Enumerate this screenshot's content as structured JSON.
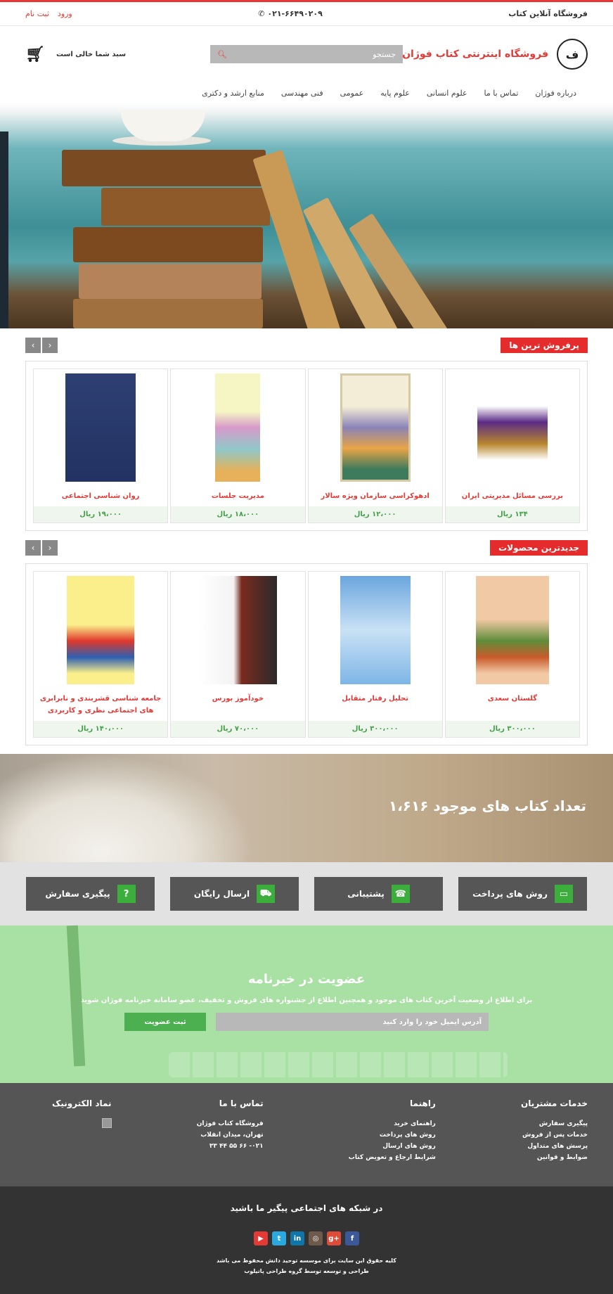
{
  "topbar": {
    "site_label": "فروشگاه آنلاین کتاب",
    "phone": "۰۲۱-۶۶۴۹۰۲۰۹",
    "login": "ورود",
    "register": "ثبت نام"
  },
  "header": {
    "store_name": "فروشگاه اینترنتی کتاب فوژان",
    "logo_text": "فوژان",
    "search_placeholder": "جستجو",
    "cart_status": "سبد شما خالی است"
  },
  "nav": {
    "items": [
      "درباره فوژان",
      "تماس با ما",
      "علوم انسانی",
      "علوم پایه",
      "عمومی",
      "فنی مهندسی",
      "منابع ارشد و دکتری"
    ]
  },
  "bestsellers": {
    "title": "پرفروش ترین ها",
    "items": [
      {
        "title": "بررسی مسائل مدیریتی ایران",
        "price": "۱۳۴ ریال"
      },
      {
        "title": "ادهوکراسی سازمان ویژه سالار",
        "price": "۱۲،۰۰۰ ریال"
      },
      {
        "title": "مدیریت جلسات",
        "price": "۱۸،۰۰۰ ریال"
      },
      {
        "title": "روان شناسی اجتماعی",
        "price": "۱۹،۰۰۰ ریال"
      }
    ]
  },
  "newest": {
    "title": "جدیدترین محصولات",
    "items": [
      {
        "title": "گلستان سعدی",
        "price": "۳۰۰،۰۰۰ ریال"
      },
      {
        "title": "تحلیل رفتار متقابل",
        "price": "۳۰۰،۰۰۰ ریال"
      },
      {
        "title": "خودآموز بورس",
        "price": "۷۰،۰۰۰ ریال"
      },
      {
        "title": "جامعه شناسی قشربندی و نابرابری های اجتماعی نظری و کاربردی",
        "price": "۱۴۰،۰۰۰ ریال"
      }
    ]
  },
  "book_count": {
    "text": "تعداد کتاب های موجود ۱،۶۱۶"
  },
  "features": [
    {
      "label": "روش های پرداخت",
      "icon": "credit-card-icon"
    },
    {
      "label": "پشتیبانی",
      "icon": "contact-card-icon"
    },
    {
      "label": "ارسال رایگان",
      "icon": "truck-icon"
    },
    {
      "label": "پیگیری سفارش",
      "icon": "question-icon"
    }
  ],
  "newsletter": {
    "title": "عضویت در خبرنامه",
    "text": "برای اطلاع از وضعیت آخرین کتاب های موجود و همچنین اطلاع از جشنواره های فروش و تخفیف، عضو سامانه خبرنامه فوژان شوید",
    "email_placeholder": "آدرس ایمیل خود را وارد کنید",
    "button": "ثبت عضویت"
  },
  "footer": {
    "columns": [
      {
        "heading": "خدمات مشتریان",
        "items": [
          "پیگیری سفارش",
          "خدمات پس از فروش",
          "پرسش های متداول",
          "ضوابط و قوانین"
        ]
      },
      {
        "heading": "راهنما",
        "items": [
          "راهنمای خرید",
          "روش های پرداخت",
          "روش های ارسال",
          "شرایط ارجاع و تعویض کتاب"
        ]
      },
      {
        "heading": "تماس با ما",
        "items": [
          "فروشگاه کتاب فوژان",
          "تهران، میدان انقلاب",
          "۰۲۱- ۶۶ ۵۵ ۴۴ ۳۳"
        ]
      },
      {
        "heading": "نماد الکترونیک",
        "items": []
      }
    ]
  },
  "bottom": {
    "social_title": "در شبکه های اجتماعی پیگیر ما باشید",
    "copyright": "کلیه حقوق این سایت برای موسسه توحید دانش محفوظ می باشد",
    "credit": "طراحی و توسعه توسط گروه طراحی پاتیلوب",
    "socials": [
      {
        "name": "youtube",
        "glyph": "▶",
        "color": "#e53935"
      },
      {
        "name": "twitter",
        "glyph": "t",
        "color": "#29a9e0"
      },
      {
        "name": "linkedin",
        "glyph": "in",
        "color": "#0e76a8"
      },
      {
        "name": "instagram",
        "glyph": "◎",
        "color": "#6d5a4a"
      },
      {
        "name": "google-plus",
        "glyph": "g+",
        "color": "#dd4b39"
      },
      {
        "name": "facebook",
        "glyph": "f",
        "color": "#3b5998"
      }
    ]
  },
  "colors": {
    "accent": "#e53935",
    "green": "#43a047",
    "footer_bg": "#555555",
    "bottom_bg": "#333333"
  }
}
